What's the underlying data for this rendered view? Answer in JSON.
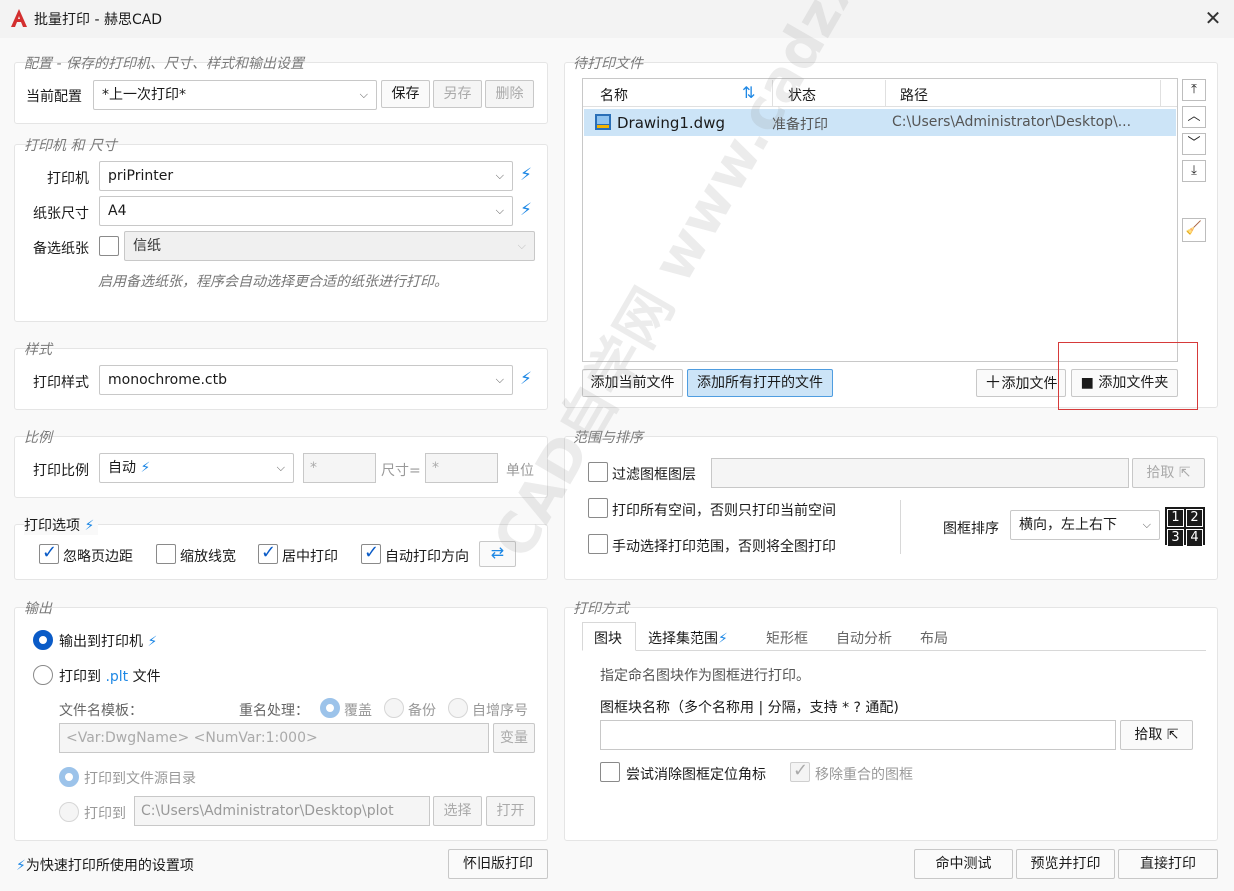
{
  "window": {
    "title": "批量打印 - 赫思CAD",
    "close_icon": "close-icon"
  },
  "config": {
    "group_title": "配置 - 保存的打印机、尺寸、样式和输出设置",
    "current_label": "当前配置",
    "current_value": "*上一次打印*",
    "save": "保存",
    "save_as": "另存",
    "delete": "删除"
  },
  "printer": {
    "group_title": "打印机 和 尺寸",
    "printer_label": "打印机",
    "printer_value": "priPrinter",
    "paper_label": "纸张尺寸",
    "paper_value": "A4",
    "alt_label": "备选纸张",
    "alt_value": "信纸",
    "hint": "启用备选纸张，程序会自动选择更合适的纸张进行打印。"
  },
  "style": {
    "group_title": "样式",
    "label": "打印样式",
    "value": "monochrome.ctb"
  },
  "scale": {
    "group_title": "比例",
    "label": "打印比例",
    "value": "自动",
    "input1": "*",
    "size_label": "尺寸=",
    "input2": "*",
    "unit_label": "单位"
  },
  "options": {
    "group_title": "打印选项",
    "ignore_margin": "忽略页边距",
    "scale_lw": "缩放线宽",
    "center": "居中打印",
    "auto_orient": "自动打印方向"
  },
  "output": {
    "group_title": "输出",
    "to_printer": "输出到打印机",
    "to_plt_prefix": "打印到 ",
    "to_plt_ext": ".plt",
    "to_plt_suffix": " 文件",
    "template_label": "文件名模板：",
    "rename_label": "重名处理：",
    "overwrite": "覆盖",
    "backup": "备份",
    "autonum": "自增序号",
    "template_value": "<Var:DwgName>  <NumVar:1:000>",
    "var_button": "变量",
    "to_src_dir": "打印到文件源目录",
    "print_to": "打印到",
    "path_value": "C:\\Users\\Administrator\\Desktop\\plot",
    "select": "选择",
    "open": "打开"
  },
  "files": {
    "group_title": "待打印文件",
    "columns": [
      "名称",
      "状态",
      "路径"
    ],
    "rows": [
      {
        "name": "Drawing1.dwg",
        "status": "准备打印",
        "path": "C:\\Users\\Administrator\\Desktop\\..."
      }
    ],
    "add_current": "添加当前文件",
    "add_all_open": "添加所有打开的文件",
    "add_file": "添加文件",
    "add_folder": "添加文件夹"
  },
  "range": {
    "group_title": "范围与排序",
    "filter_layer": "过滤图框图层",
    "pick": "拾取",
    "all_space": "打印所有空间，否则只打印当前空间",
    "manual_select": "手动选择打印范围，否则将全图打印",
    "sort_label": "图框排序",
    "sort_value": "横向，左上右下",
    "order_digits": [
      "1",
      "2",
      "3",
      "4"
    ]
  },
  "method": {
    "group_title": "打印方式",
    "tabs": [
      "图块",
      "选择集范围",
      "矩形框",
      "自动分析",
      "布局"
    ],
    "desc": "指定命名图块作为图框进行打印。",
    "block_label": "图框块名称（多个名称用 | 分隔，支持 * ? 通配)",
    "pick": "拾取",
    "try_remove": "尝试消除图框定位角标",
    "remove_overlap": "移除重合的图框"
  },
  "footer": {
    "note": "为快速打印所使用的设置项",
    "legacy": "怀旧版打印",
    "hit_test": "命中测试",
    "preview": "预览并打印",
    "direct": "直接打印"
  },
  "watermark": "CAD自学网 www.cadzxw.com",
  "colors": {
    "accent": "#0a5bc7",
    "bolt": "#1e88e5",
    "highlight": "#cce4f7",
    "red_box": "#d63a3a"
  }
}
